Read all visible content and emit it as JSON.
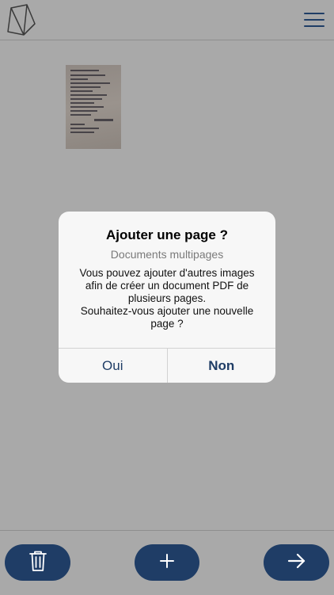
{
  "header": {
    "logo_icon": "faceted-stone-logo-icon",
    "menu_icon": "hamburger-menu-icon"
  },
  "document": {
    "thumbnail_description_icon": "receipt-thumbnail"
  },
  "dialog": {
    "title": "Ajouter une page ?",
    "subtitle": "Documents multipages",
    "message_lines": [
      "Vous pouvez ajouter d'autres images",
      "afin de créer un document PDF de",
      "plusieurs pages.",
      "Souhaitez-vous ajouter une nouvelle",
      "page ?"
    ],
    "yes_label": "Oui",
    "no_label": "Non"
  },
  "toolbar": {
    "delete_icon": "trash-icon",
    "add_icon": "plus-icon",
    "next_icon": "arrow-right-icon"
  },
  "colors": {
    "accent": "#1f3d66",
    "overlay_background": "#a9a9a9",
    "dialog_background": "#f7f7f7"
  }
}
